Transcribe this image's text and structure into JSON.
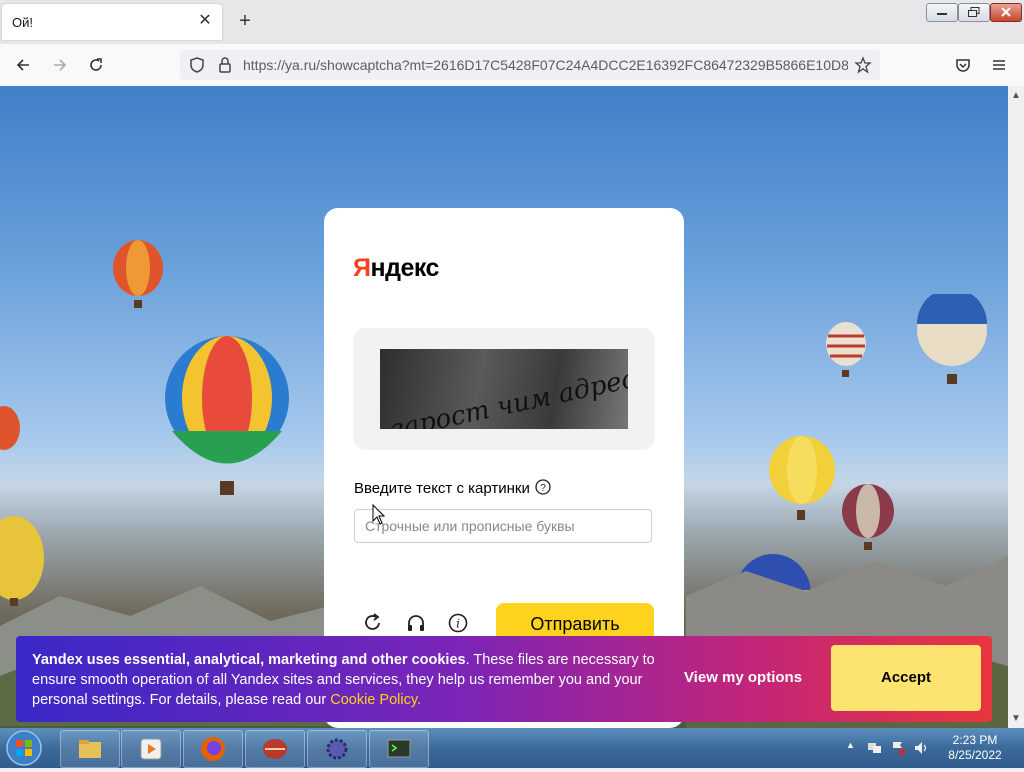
{
  "browser": {
    "tab_title": "Ой!",
    "new_tab_label": "+",
    "url": "https://ya.ru/showcaptcha?mt=2616D17C5428F07C24A4DCC2E16392FC86472329B5866E10D8",
    "icons": [
      "back-icon",
      "forward-icon",
      "reload-icon",
      "shield-icon",
      "lock-icon",
      "star-icon",
      "pocket-icon",
      "menu-icon"
    ]
  },
  "captcha_page": {
    "logo_ya": "Я",
    "logo_rest": "ндекс",
    "captcha_text": "зарост чим адрес у",
    "prompt": "Введите текст с картинки",
    "input_placeholder": "Строчные или прописные буквы",
    "input_value": "",
    "submit_label": "Отправить"
  },
  "cookie_banner": {
    "bold_text": "Yandex uses essential, analytical, marketing and other cookies",
    "body_text": ". These files are necessary to ensure smooth operation of all Yandex sites and services, they help us remember you and your personal settings. For details, please read our ",
    "link_text": "Cookie Policy.",
    "view_options_label": "View my options",
    "accept_label": "Accept"
  },
  "taskbar": {
    "time": "2:23 PM",
    "date": "8/25/2022"
  },
  "colors": {
    "brand_red": "#fc3f1d",
    "submit_yellow": "#ffd21e",
    "accept_yellow": "#fde36f"
  }
}
